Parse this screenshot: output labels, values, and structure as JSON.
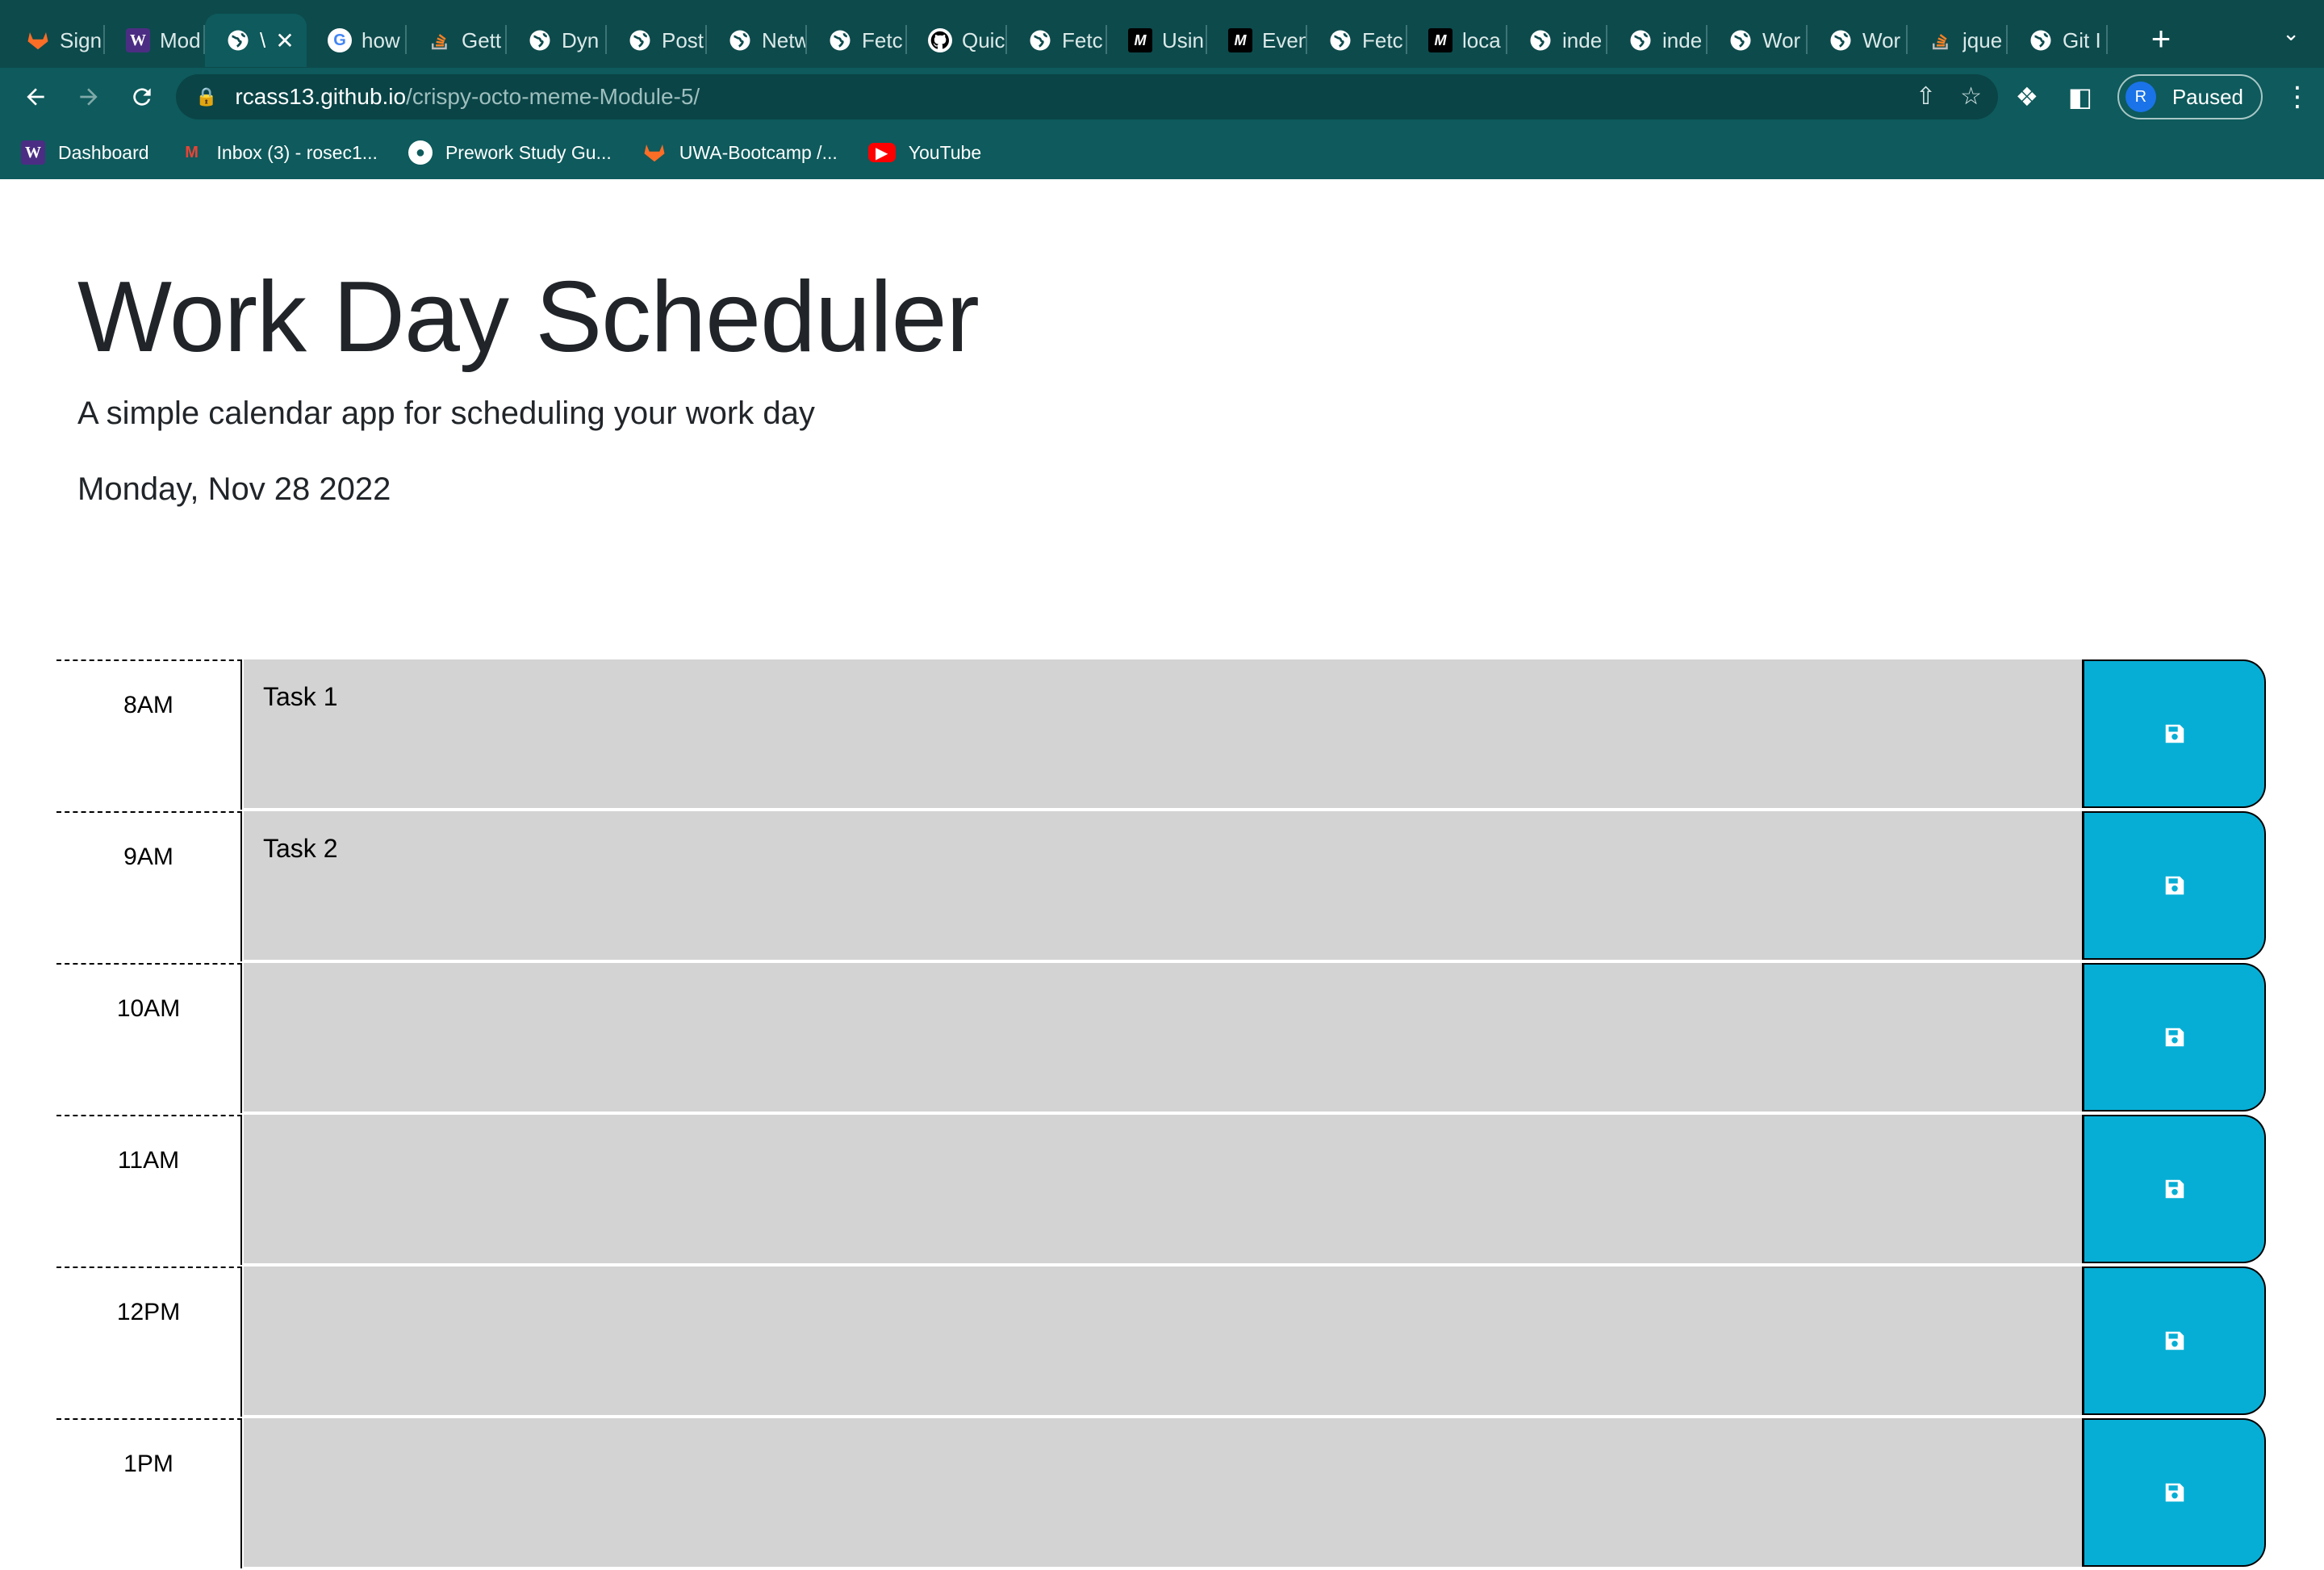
{
  "browser": {
    "tabs": [
      {
        "title": "Sign",
        "icon": "gitlab-icon",
        "active": false
      },
      {
        "title": "Mod",
        "icon": "w-brand-icon",
        "active": false
      },
      {
        "title": "\\",
        "icon": "globe-icon",
        "active": true
      },
      {
        "title": "how",
        "icon": "google-icon",
        "active": false
      },
      {
        "title": "Gett",
        "icon": "stackoverflow-icon",
        "active": false
      },
      {
        "title": "Dyn",
        "icon": "globe-icon",
        "active": false
      },
      {
        "title": "Post",
        "icon": "globe-icon",
        "active": false
      },
      {
        "title": "Netw",
        "icon": "globe-icon",
        "active": false
      },
      {
        "title": "Fetc",
        "icon": "globe-icon",
        "active": false
      },
      {
        "title": "Quic",
        "icon": "github-icon",
        "active": false
      },
      {
        "title": "Fetc",
        "icon": "globe-icon",
        "active": false
      },
      {
        "title": "Usin",
        "icon": "mdn-icon",
        "active": false
      },
      {
        "title": "Even",
        "icon": "mdn-icon",
        "active": false
      },
      {
        "title": "Fetc",
        "icon": "globe-icon",
        "active": false
      },
      {
        "title": "loca",
        "icon": "mdn-icon",
        "active": false
      },
      {
        "title": "inde",
        "icon": "globe-icon",
        "active": false
      },
      {
        "title": "inde",
        "icon": "globe-icon",
        "active": false
      },
      {
        "title": "Wor",
        "icon": "globe-icon",
        "active": false
      },
      {
        "title": "Wor",
        "icon": "globe-icon",
        "active": false
      },
      {
        "title": "jque",
        "icon": "stackoverflow-icon",
        "active": false
      },
      {
        "title": "Git I",
        "icon": "globe-icon",
        "active": false
      }
    ],
    "url_host": "rcass13.github.io",
    "url_path": "/crispy-octo-meme-Module-5/",
    "profile_initial": "R",
    "profile_status": "Paused",
    "bookmarks": [
      {
        "label": "Dashboard",
        "icon": "w-brand-icon"
      },
      {
        "label": "Inbox (3) - rosec1...",
        "icon": "gmail-icon"
      },
      {
        "label": "Prework Study Gu...",
        "icon": "globe-icon"
      },
      {
        "label": "UWA-Bootcamp /...",
        "icon": "gitlab-icon"
      },
      {
        "label": "YouTube",
        "icon": "youtube-icon"
      }
    ]
  },
  "header": {
    "title": "Work Day Scheduler",
    "lead": "A simple calendar app for scheduling your work day",
    "current_day": "Monday, Nov 28 2022"
  },
  "schedule": {
    "rows": [
      {
        "hour": "8AM",
        "text": "Task 1"
      },
      {
        "hour": "9AM",
        "text": "Task 2"
      },
      {
        "hour": "10AM",
        "text": ""
      },
      {
        "hour": "11AM",
        "text": ""
      },
      {
        "hour": "12PM",
        "text": ""
      },
      {
        "hour": "1PM",
        "text": ""
      }
    ]
  },
  "colors": {
    "chrome_bg": "#0e5a5c",
    "tabstrip_bg": "#0d4a4c",
    "row_bg": "#d3d3d3",
    "save_button": "#06aed5"
  }
}
